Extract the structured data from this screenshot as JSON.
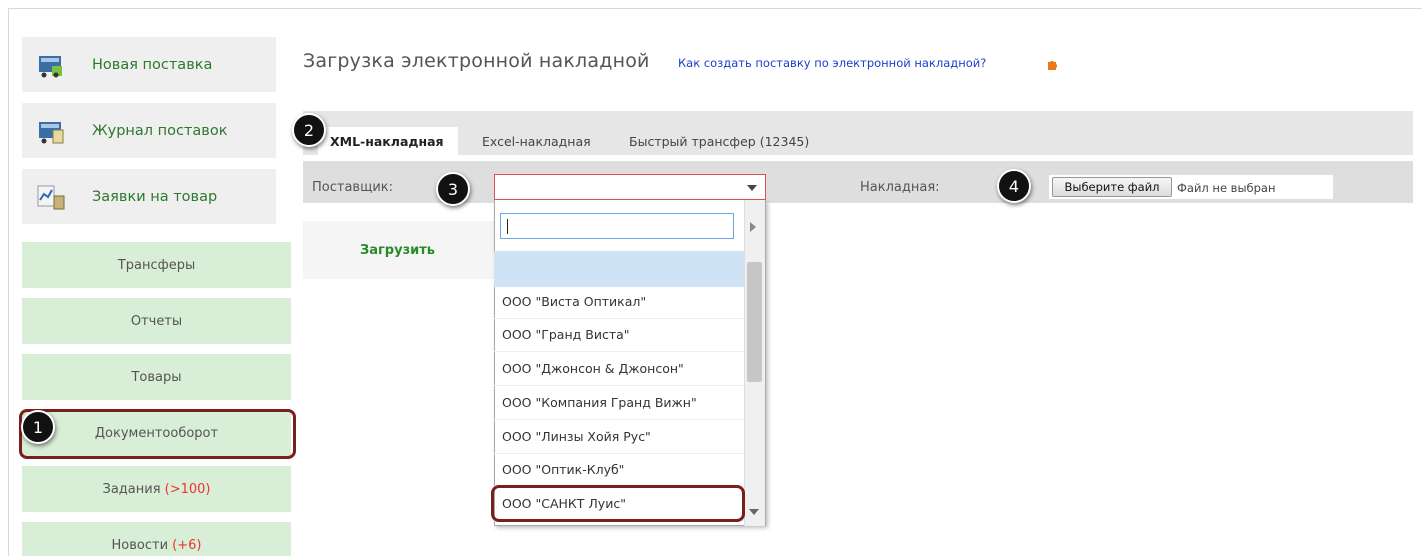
{
  "sidebar": {
    "top_items": [
      {
        "label": "Новая поставка",
        "icon": "delivery-cart-icon"
      },
      {
        "label": "Журнал поставок",
        "icon": "journal-cart-icon"
      },
      {
        "label": "Заявки на товар",
        "icon": "request-chart-icon"
      }
    ],
    "nav_items": [
      {
        "label": "Трансферы"
      },
      {
        "label": "Отчеты"
      },
      {
        "label": "Товары"
      },
      {
        "label": "Документооборот"
      },
      {
        "label": "Задания",
        "badge": "(>100)"
      },
      {
        "label": "Новости",
        "badge": "(+6)"
      }
    ]
  },
  "main": {
    "title": "Загрузка электронной накладной",
    "help_link": "Как создать поставку по электронной накладной?",
    "tabs": [
      {
        "label": "XML-накладная",
        "active": true
      },
      {
        "label": "Excel-накладная",
        "active": false
      },
      {
        "label": "Быстрый трансфер (12345)",
        "active": false
      }
    ],
    "form": {
      "supplier_label": "Поставщик:",
      "invoice_label": "Накладная:",
      "file_button": "Выберите файл",
      "file_status": "Файл не выбран",
      "upload_label": "Загрузить"
    },
    "dropdown": {
      "search_value": "",
      "options": [
        "",
        "ООО \"Виста Оптикал\"",
        "ООО \"Гранд Виста\"",
        "ООО \"Джонсон & Джонсон\"",
        "ООО \"Компания Гранд Вижн\"",
        "ООО \"Линзы Хойя Рус\"",
        "ООО \"Оптик-Клуб\"",
        "ООО \"САНКТ Луис\""
      ]
    }
  },
  "markers": [
    "1",
    "2",
    "3",
    "4"
  ],
  "colors": {
    "accent_green": "#2c7a2c",
    "nav_green_bg": "#d9eed6",
    "highlight_red": "#7a1f1f",
    "link_blue": "#1a3fcc",
    "badge_red": "#e33333"
  }
}
